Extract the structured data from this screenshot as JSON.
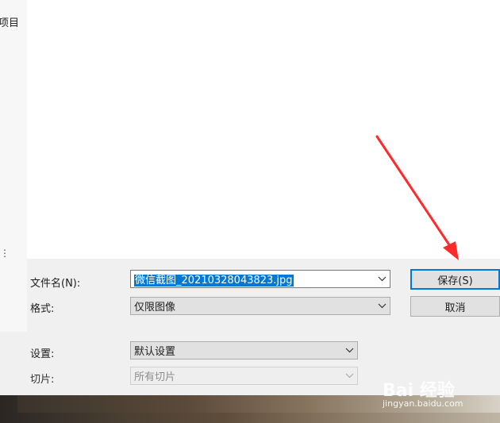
{
  "sidebar": {
    "partial_label": "项目",
    "partial_mark": "⋮"
  },
  "form": {
    "filename_label": "文件名(N):",
    "filename_value": "微信截图_20210328043823.jpg",
    "format_label": "格式:",
    "format_value": "仅限图像",
    "settings_label": "设置:",
    "settings_value": "默认设置",
    "slices_label": "切片:",
    "slices_value": "所有切片"
  },
  "buttons": {
    "save": "保存(S)",
    "cancel": "取消"
  },
  "watermark": {
    "logo": "Bai 经验",
    "url": "jingyan.baidu.com"
  },
  "annotation": {
    "arrow_color": "#ff2a2a"
  },
  "icons": {
    "dropdown": "chevron-down-icon"
  }
}
